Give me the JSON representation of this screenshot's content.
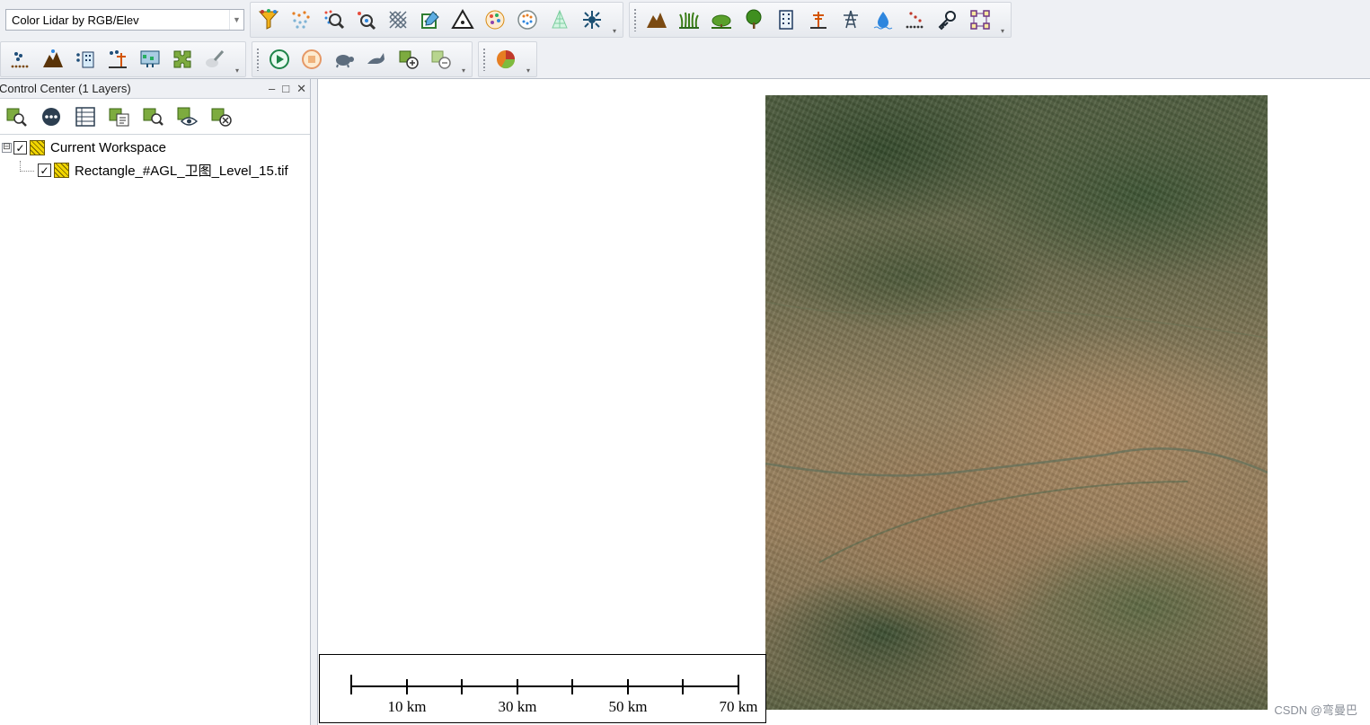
{
  "toolbar": {
    "style_combo": {
      "selected": "Color Lidar by RGB/Elev"
    },
    "row1_group1_icons": [
      "funnel-filter-icon",
      "lidar-points-icon",
      "lidar-search-icon",
      "point-search-icon",
      "grid-classify-icon",
      "edit-checkbox-icon",
      "triangle-tin-icon",
      "color-points-icon",
      "point-pattern-icon",
      "tree-wireframe-icon",
      "network-bug-icon"
    ],
    "row1_group2_icons": [
      "terrain-mountain-icon",
      "grass-vegetation-icon",
      "tree-low-icon",
      "tree-high-icon",
      "building-icon",
      "powerline-pole-icon",
      "transmission-tower-icon",
      "water-drop-icon",
      "noise-points-icon",
      "key-tool-icon",
      "topology-icon"
    ],
    "row2_group1_icons": [
      "point-cloud-icon",
      "ground-terrain-icon",
      "building-grid-icon",
      "tower-points-icon",
      "pixel-map-icon",
      "puzzle-tile-icon",
      "paint-brush-icon"
    ],
    "row2_group2_icons": [
      "play-icon",
      "stop-icon",
      "turtle-slow-icon",
      "rabbit-fast-icon",
      "zoom-in-layer-icon",
      "zoom-out-layer-icon"
    ],
    "row2_group3_icons": [
      "pie-color-icon"
    ]
  },
  "control_center": {
    "title": "Control Center (1 Layers)",
    "controls": {
      "minimize": "–",
      "restore": "□",
      "close": "✕"
    },
    "tool_icons": [
      "zoom-to-layer-icon",
      "more-options-icon",
      "attribute-table-icon",
      "layer-properties-icon",
      "layer-search-icon",
      "layer-visibility-icon",
      "remove-layer-icon"
    ],
    "workspace": {
      "label": "Current Workspace",
      "checked": true,
      "expander": "⊟"
    },
    "layers": [
      {
        "label": "Rectangle_#AGL_卫图_Level_15.tif",
        "checked": true
      }
    ]
  },
  "map": {
    "scale_labels": [
      "10 km",
      "30 km",
      "50 km",
      "70 km"
    ]
  },
  "watermark": "CSDN @弯曼巴"
}
